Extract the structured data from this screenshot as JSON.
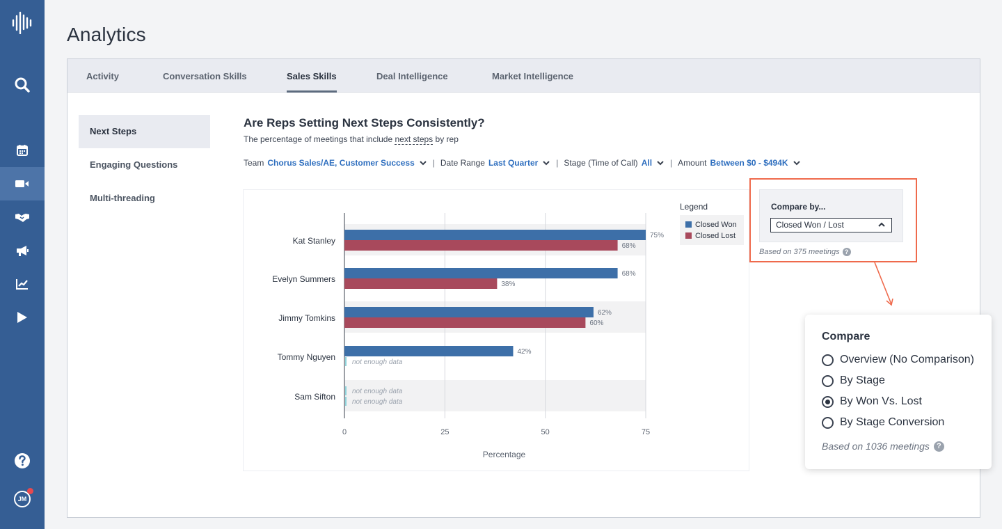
{
  "page": {
    "title": "Analytics"
  },
  "sidebar": {
    "icons": [
      "logo-bars-icon",
      "search-icon",
      "calendar-icon",
      "video-icon",
      "handshake-icon",
      "megaphone-icon",
      "line-chart-icon",
      "play-icon",
      "help-icon"
    ],
    "avatar_initials": "JM",
    "active_index": 3
  },
  "tabs": [
    "Activity",
    "Conversation Skills",
    "Sales Skills",
    "Deal Intelligence",
    "Market Intelligence"
  ],
  "active_tab": "Sales Skills",
  "subnav": [
    "Next Steps",
    "Engaging Questions",
    "Multi-threading"
  ],
  "active_subnav": "Next Steps",
  "main": {
    "heading": "Are Reps Setting Next Steps Consistently?",
    "subheading_prefix": "The percentage of meetings that include ",
    "subheading_link": "next steps",
    "subheading_suffix": " by rep"
  },
  "filters": {
    "team_label": "Team",
    "team_value": "Chorus Sales/AE, Customer Success",
    "date_label": "Date Range",
    "date_value": "Last Quarter",
    "stage_label": "Stage (Time of Call)",
    "stage_value": "All",
    "amount_label": "Amount",
    "amount_value": "Between $0 - $494K"
  },
  "compare_box": {
    "title": "Compare by...",
    "selected": "Closed Won / Lost",
    "based_on": "Based on 375 meetings"
  },
  "popover": {
    "title": "Compare",
    "options": [
      "Overview (No Comparison)",
      "By Stage",
      "By Won Vs. Lost",
      "By Stage Conversion"
    ],
    "selected_index": 2,
    "based_on": "Based on 1036 meetings"
  },
  "colors": {
    "won": "#3d6fa8",
    "lost": "#a8495c",
    "accent": "#2f6fbf",
    "highlight": "#ef6a4c",
    "sidebar": "#355e94"
  },
  "chart_data": {
    "type": "bar",
    "orientation": "horizontal",
    "categories": [
      "Kat Stanley",
      "Evelyn Summers",
      "Jimmy Tomkins",
      "Tommy Nguyen",
      "Sam Sifton"
    ],
    "series": [
      {
        "name": "Closed Won",
        "values": [
          75,
          68,
          62,
          42,
          null
        ]
      },
      {
        "name": "Closed Lost",
        "values": [
          68,
          38,
          60,
          null,
          null
        ]
      }
    ],
    "data_labels": [
      [
        "75%",
        "68%",
        "62%",
        "42%",
        "not enough data"
      ],
      [
        "68%",
        "38%",
        "60%",
        "not enough data",
        "not enough data"
      ]
    ],
    "no_data_label": "not enough data",
    "xlabel": "Percentage",
    "xticks": [
      0,
      25,
      50,
      75
    ],
    "xlim": [
      0,
      75
    ],
    "legend_title": "Legend",
    "legend_position": "top-right",
    "grid": true
  }
}
